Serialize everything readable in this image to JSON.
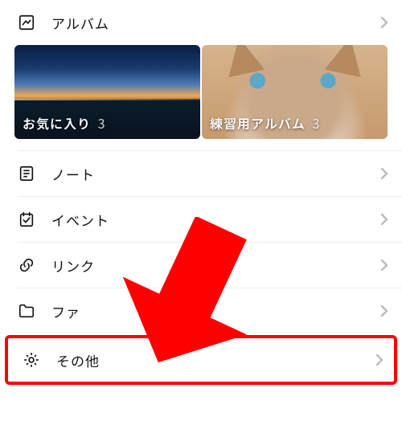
{
  "album": {
    "label": "アルバム",
    "items": [
      {
        "title": "お気に入り",
        "count": "3"
      },
      {
        "title": "練習用アルバム",
        "count": "3"
      }
    ]
  },
  "menu": {
    "note": "ノート",
    "event": "イベント",
    "link": "リンク",
    "file": "ファ",
    "other": "その他"
  },
  "colors": {
    "highlight": "#ff0000"
  }
}
